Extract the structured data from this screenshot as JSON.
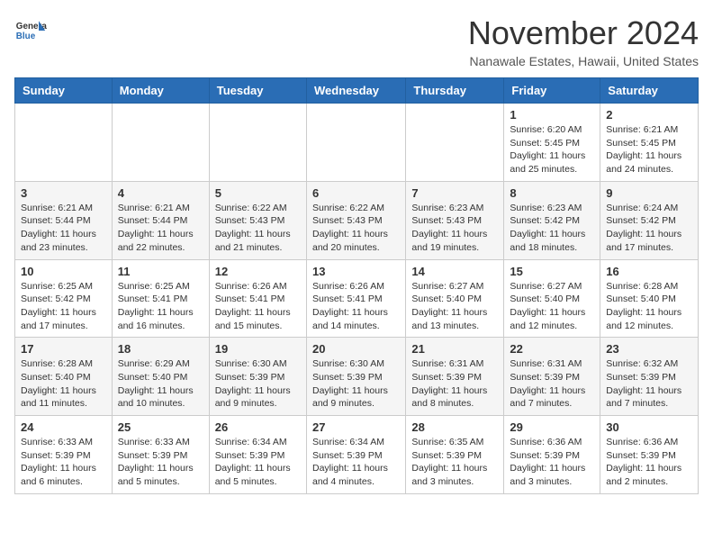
{
  "header": {
    "logo_general": "General",
    "logo_blue": "Blue",
    "month_title": "November 2024",
    "location": "Nanawale Estates, Hawaii, United States"
  },
  "weekdays": [
    "Sunday",
    "Monday",
    "Tuesday",
    "Wednesday",
    "Thursday",
    "Friday",
    "Saturday"
  ],
  "weeks": [
    [
      {
        "day": "",
        "empty": true
      },
      {
        "day": "",
        "empty": true
      },
      {
        "day": "",
        "empty": true
      },
      {
        "day": "",
        "empty": true
      },
      {
        "day": "",
        "empty": true
      },
      {
        "day": "1",
        "sunrise": "6:20 AM",
        "sunset": "5:45 PM",
        "daylight": "11 hours and 25 minutes."
      },
      {
        "day": "2",
        "sunrise": "6:21 AM",
        "sunset": "5:45 PM",
        "daylight": "11 hours and 24 minutes."
      }
    ],
    [
      {
        "day": "3",
        "sunrise": "6:21 AM",
        "sunset": "5:44 PM",
        "daylight": "11 hours and 23 minutes."
      },
      {
        "day": "4",
        "sunrise": "6:21 AM",
        "sunset": "5:44 PM",
        "daylight": "11 hours and 22 minutes."
      },
      {
        "day": "5",
        "sunrise": "6:22 AM",
        "sunset": "5:43 PM",
        "daylight": "11 hours and 21 minutes."
      },
      {
        "day": "6",
        "sunrise": "6:22 AM",
        "sunset": "5:43 PM",
        "daylight": "11 hours and 20 minutes."
      },
      {
        "day": "7",
        "sunrise": "6:23 AM",
        "sunset": "5:43 PM",
        "daylight": "11 hours and 19 minutes."
      },
      {
        "day": "8",
        "sunrise": "6:23 AM",
        "sunset": "5:42 PM",
        "daylight": "11 hours and 18 minutes."
      },
      {
        "day": "9",
        "sunrise": "6:24 AM",
        "sunset": "5:42 PM",
        "daylight": "11 hours and 17 minutes."
      }
    ],
    [
      {
        "day": "10",
        "sunrise": "6:25 AM",
        "sunset": "5:42 PM",
        "daylight": "11 hours and 17 minutes."
      },
      {
        "day": "11",
        "sunrise": "6:25 AM",
        "sunset": "5:41 PM",
        "daylight": "11 hours and 16 minutes."
      },
      {
        "day": "12",
        "sunrise": "6:26 AM",
        "sunset": "5:41 PM",
        "daylight": "11 hours and 15 minutes."
      },
      {
        "day": "13",
        "sunrise": "6:26 AM",
        "sunset": "5:41 PM",
        "daylight": "11 hours and 14 minutes."
      },
      {
        "day": "14",
        "sunrise": "6:27 AM",
        "sunset": "5:40 PM",
        "daylight": "11 hours and 13 minutes."
      },
      {
        "day": "15",
        "sunrise": "6:27 AM",
        "sunset": "5:40 PM",
        "daylight": "11 hours and 12 minutes."
      },
      {
        "day": "16",
        "sunrise": "6:28 AM",
        "sunset": "5:40 PM",
        "daylight": "11 hours and 12 minutes."
      }
    ],
    [
      {
        "day": "17",
        "sunrise": "6:28 AM",
        "sunset": "5:40 PM",
        "daylight": "11 hours and 11 minutes."
      },
      {
        "day": "18",
        "sunrise": "6:29 AM",
        "sunset": "5:40 PM",
        "daylight": "11 hours and 10 minutes."
      },
      {
        "day": "19",
        "sunrise": "6:30 AM",
        "sunset": "5:39 PM",
        "daylight": "11 hours and 9 minutes."
      },
      {
        "day": "20",
        "sunrise": "6:30 AM",
        "sunset": "5:39 PM",
        "daylight": "11 hours and 9 minutes."
      },
      {
        "day": "21",
        "sunrise": "6:31 AM",
        "sunset": "5:39 PM",
        "daylight": "11 hours and 8 minutes."
      },
      {
        "day": "22",
        "sunrise": "6:31 AM",
        "sunset": "5:39 PM",
        "daylight": "11 hours and 7 minutes."
      },
      {
        "day": "23",
        "sunrise": "6:32 AM",
        "sunset": "5:39 PM",
        "daylight": "11 hours and 7 minutes."
      }
    ],
    [
      {
        "day": "24",
        "sunrise": "6:33 AM",
        "sunset": "5:39 PM",
        "daylight": "11 hours and 6 minutes."
      },
      {
        "day": "25",
        "sunrise": "6:33 AM",
        "sunset": "5:39 PM",
        "daylight": "11 hours and 5 minutes."
      },
      {
        "day": "26",
        "sunrise": "6:34 AM",
        "sunset": "5:39 PM",
        "daylight": "11 hours and 5 minutes."
      },
      {
        "day": "27",
        "sunrise": "6:34 AM",
        "sunset": "5:39 PM",
        "daylight": "11 hours and 4 minutes."
      },
      {
        "day": "28",
        "sunrise": "6:35 AM",
        "sunset": "5:39 PM",
        "daylight": "11 hours and 3 minutes."
      },
      {
        "day": "29",
        "sunrise": "6:36 AM",
        "sunset": "5:39 PM",
        "daylight": "11 hours and 3 minutes."
      },
      {
        "day": "30",
        "sunrise": "6:36 AM",
        "sunset": "5:39 PM",
        "daylight": "11 hours and 2 minutes."
      }
    ]
  ]
}
